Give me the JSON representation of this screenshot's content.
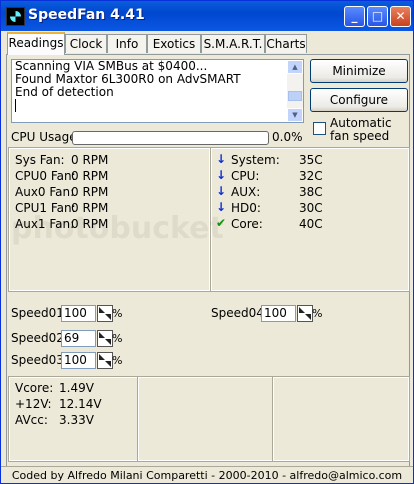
{
  "window": {
    "title": "SpeedFan 4.41"
  },
  "tabs": [
    "Readings",
    "Clock",
    "Info",
    "Exotics",
    "S.M.A.R.T.",
    "Charts"
  ],
  "log": {
    "lines": [
      "Scanning VIA SMBus at $0400...",
      "Found Maxtor 6L300R0 on AdvSMART",
      "End of detection"
    ]
  },
  "buttons": {
    "minimize": "Minimize",
    "configure": "Configure"
  },
  "auto_fan": {
    "label": "Automatic fan speed",
    "checked": false
  },
  "cpu_usage": {
    "label": "CPU Usage",
    "percent_text": "0.0%",
    "value": 0.0
  },
  "fans": [
    {
      "label": "Sys Fan:",
      "value": "0 RPM"
    },
    {
      "label": "CPU0 Fan:",
      "value": "0 RPM"
    },
    {
      "label": "Aux0 Fan:",
      "value": "0 RPM"
    },
    {
      "label": "CPU1 Fan:",
      "value": "0 RPM"
    },
    {
      "label": "Aux1 Fan:",
      "value": "0 RPM"
    }
  ],
  "temps": [
    {
      "label": "System:",
      "value": "35C",
      "icon": "arrow-down-icon"
    },
    {
      "label": "CPU:",
      "value": "32C",
      "icon": "arrow-down-icon"
    },
    {
      "label": "AUX:",
      "value": "38C",
      "icon": "arrow-down-icon"
    },
    {
      "label": "HD0:",
      "value": "30C",
      "icon": "arrow-down-icon"
    },
    {
      "label": "Core:",
      "value": "40C",
      "icon": "checkmark-icon"
    }
  ],
  "speeds": [
    {
      "label": "Speed01:",
      "value": "100",
      "unit": "%"
    },
    {
      "label": "Speed02:",
      "value": "69",
      "unit": "%"
    },
    {
      "label": "Speed03:",
      "value": "100",
      "unit": "%"
    },
    {
      "label": "Speed04:",
      "value": "100",
      "unit": "%"
    }
  ],
  "voltages": [
    {
      "label": "Vcore:",
      "value": "1.49V"
    },
    {
      "label": "+12V:",
      "value": "12.14V"
    },
    {
      "label": "AVcc:",
      "value": "3.33V"
    }
  ],
  "status_bar": "Coded by Alfredo Milani Comparetti - 2000-2010 - alfredo@almico.com",
  "watermark": "photobucket",
  "colors": {
    "titlebar": "#0047cf",
    "cpu_bar": "#2fbc2f",
    "arrow": "#0d2ed9",
    "check": "#0c9b0c"
  }
}
